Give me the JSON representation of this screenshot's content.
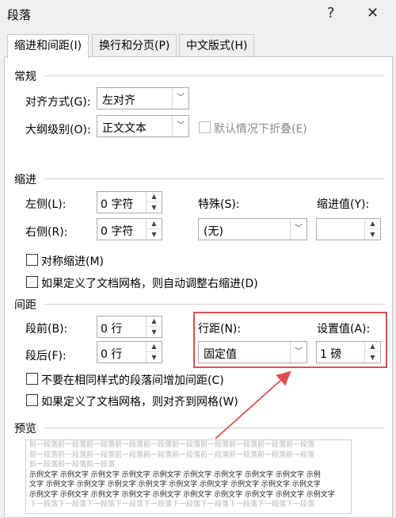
{
  "dialog": {
    "title": "段落",
    "help_glyph": "?",
    "close_glyph": "✕"
  },
  "tabs": [
    {
      "label": "缩进和间距(I)"
    },
    {
      "label": "换行和分页(P)"
    },
    {
      "label": "中文版式(H)"
    }
  ],
  "general": {
    "heading": "常规",
    "alignment_label": "对齐方式(G):",
    "alignment_value": "左对齐",
    "outline_label": "大纲级别(O):",
    "outline_value": "正文文本",
    "collapse_label": "默认情况下折叠(E)"
  },
  "indent": {
    "heading": "缩进",
    "left_label": "左侧(L):",
    "left_value": "0 字符",
    "right_label": "右侧(R):",
    "right_value": "0 字符",
    "special_label": "特殊(S):",
    "special_value": "(无)",
    "indent_by_label": "缩进值(Y):",
    "indent_by_value": "",
    "mirror_label": "对称缩进(M)",
    "auto_adjust_label": "如果定义了文档网格，则自动调整右缩进(D)"
  },
  "spacing": {
    "heading": "间距",
    "before_label": "段前(B):",
    "before_value": "0 行",
    "after_label": "段后(F):",
    "after_value": "0 行",
    "line_spacing_label": "行距(N):",
    "line_spacing_value": "固定值",
    "at_label": "设置值(A):",
    "at_value": "1 磅",
    "no_space_label": "不要在相同样式的段落间增加间距(C)",
    "snap_grid_label": "如果定义了文档网格，则对齐到网格(W)"
  },
  "preview": {
    "heading": "预览",
    "prev_para_lines": [
      "前一段落前一段落前一段落前一段落前一段落前一段落前一段落前一段落前一段落前一段落",
      "前一段落前一段落前一段落前一段落前一段落前一段落前一段落前一段落前一段落前一段落",
      "前一段落前一段落前一段落"
    ],
    "sample_lines": [
      "示例文字  示例文字  示例文字  示例文字  示例文字  示例文字  示例文字  示例文字  示例文字  示例",
      "文字  示例文字  示例文字  示例文字  示例文字  示例文字  示例文字  示例文字  示例文字  示例文字",
      "示例文字  示例文字  示例文字  示例文字  示例文字  示例文字  示例文字  示例文字  示例文字  示例文字"
    ],
    "next_para_lines": [
      "下一段落下一段落下一段落下一段落下一段落下一段落下一段落下一段落下一段落下一段落"
    ]
  },
  "colors": {
    "highlight_box": "#e05050",
    "arrow": "#e05050"
  }
}
